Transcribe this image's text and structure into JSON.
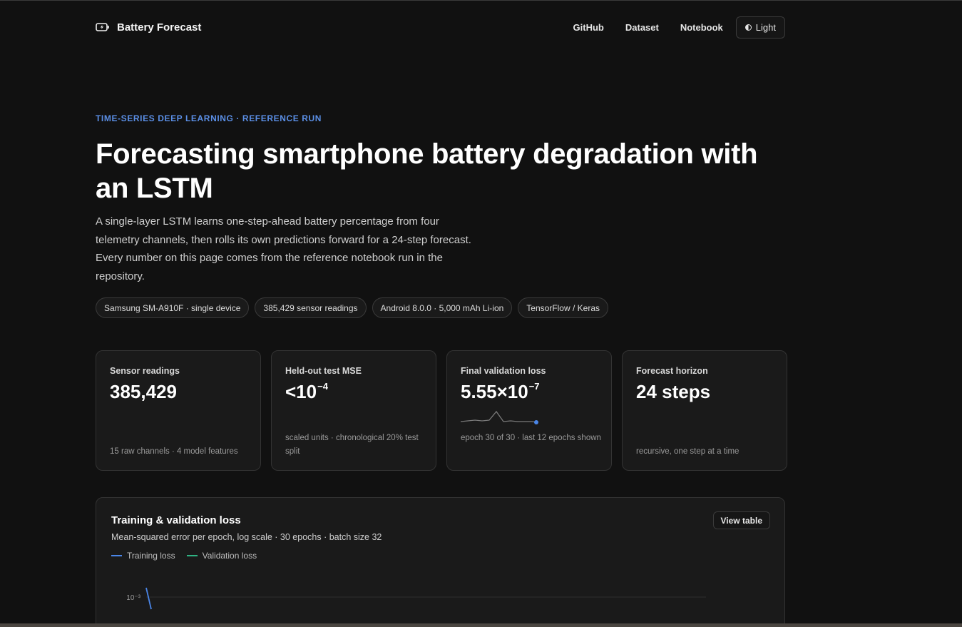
{
  "header": {
    "brand": "Battery Forecast",
    "nav": [
      "GitHub",
      "Dataset",
      "Notebook"
    ],
    "theme_toggle": "Light"
  },
  "hero": {
    "eyebrow": "TIME-SERIES DEEP LEARNING · REFERENCE RUN",
    "title": "Forecasting smartphone battery degradation with an LSTM",
    "lead": "A single-layer LSTM learns one-step-ahead battery percentage from four telemetry channels, then rolls its own predictions forward for a 24-step forecast. Every number on this page comes from the reference notebook run in the repository.",
    "chips": [
      "Samsung SM-A910F · single device",
      "385,429 sensor readings",
      "Android 8.0.0 · 5,000 mAh Li-ion",
      "TensorFlow / Keras"
    ]
  },
  "stats": [
    {
      "label": "Sensor readings",
      "value": "385,429",
      "sup": "",
      "note": "15 raw channels · 4 model features"
    },
    {
      "label": "Held-out test MSE",
      "value": "<10",
      "sup": "−4",
      "note": "scaled units · chronological 20% test split"
    },
    {
      "label": "Final validation loss",
      "value": "5.55×10",
      "sup": "−7",
      "note": "epoch 30 of 30 · last 12 epochs shown"
    },
    {
      "label": "Forecast horizon",
      "value": "24 steps",
      "sup": "",
      "note": "recursive, one step at a time"
    }
  ],
  "colors": {
    "accent": "#5b8fe6",
    "training": "#4a86e8",
    "validation": "#2fb383"
  },
  "panel": {
    "title": "Training & validation loss",
    "subtitle": "Mean-squared error per epoch, log scale · 30 epochs · batch size 32",
    "view_table": "View table",
    "legend": [
      "Training loss",
      "Validation loss"
    ]
  },
  "chart_data": {
    "type": "line",
    "scale": "log",
    "x": [
      1,
      2
    ],
    "series": [
      {
        "name": "Training loss",
        "values": [
          0.001,
          0.0005
        ]
      }
    ],
    "ytick_labels": [
      "10⁻³"
    ]
  }
}
